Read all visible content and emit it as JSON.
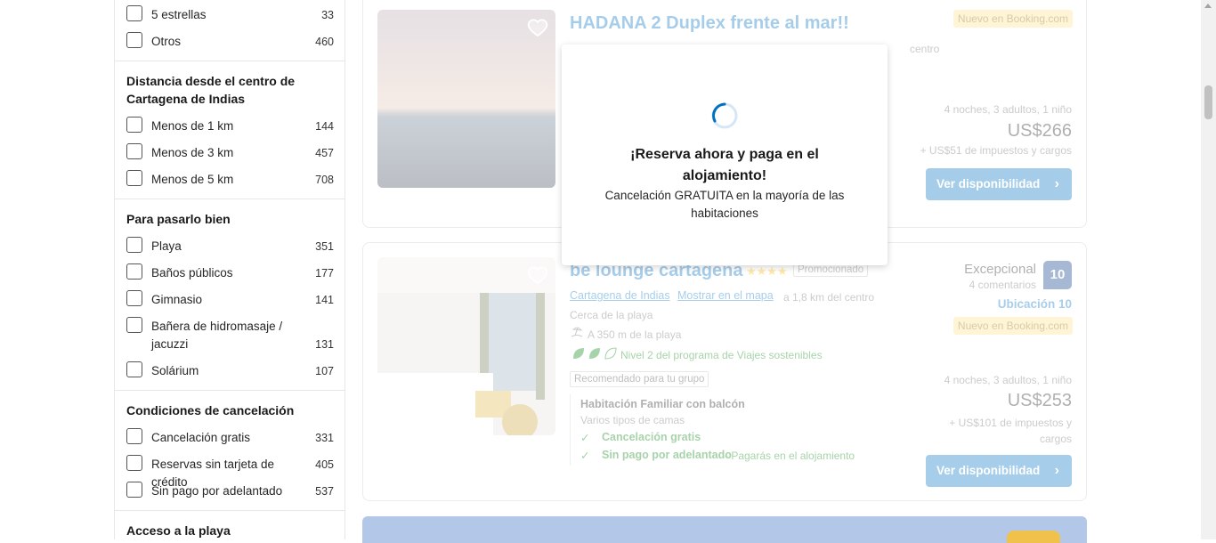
{
  "sidebar": {
    "stars": [
      {
        "label": "5 estrellas",
        "count": "33"
      },
      {
        "label": "Otros",
        "count": "460"
      }
    ],
    "distance": {
      "title": "Distancia desde el centro de Cartagena de Indias",
      "items": [
        {
          "label": "Menos de 1 km",
          "count": "144"
        },
        {
          "label": "Menos de 3 km",
          "count": "457"
        },
        {
          "label": "Menos de 5 km",
          "count": "708"
        }
      ]
    },
    "fun": {
      "title": "Para pasarlo bien",
      "items": [
        {
          "label": "Playa",
          "count": "351"
        },
        {
          "label": "Baños públicos",
          "count": "177"
        },
        {
          "label": "Gimnasio",
          "count": "141"
        },
        {
          "label": "Bañera de hidromasaje / jacuzzi",
          "count": "131"
        },
        {
          "label": "Solárium",
          "count": "107"
        }
      ]
    },
    "cancel": {
      "title": "Condiciones de cancelación",
      "items": [
        {
          "label": "Cancelación gratis",
          "count": "331"
        },
        {
          "label": "Reservas sin tarjeta de crédito",
          "count": "405"
        },
        {
          "label": "Sin pago por adelantado",
          "count": "537"
        }
      ]
    },
    "beach": {
      "title": "Acceso a la playa"
    }
  },
  "property1": {
    "title": "HADANA 2 Duplex frente al mar!!",
    "badge": "Nuevo en Booking.com",
    "subtitle_partial": "centro",
    "stay": "4 noches, 3 adultos, 1 niño",
    "price": "US$266",
    "taxes": "+ US$51 de impuestos y cargos",
    "button": "Ver disponibilidad"
  },
  "property2": {
    "title": "be lounge cartagena",
    "promoted": "Promocionado",
    "location_link": "Cartagena de Indias",
    "map_link": "Mostrar en el mapa",
    "distance": "a 1,8 km del centro",
    "near_beach": "Cerca de la playa",
    "beach_distance": "A 350 m de la playa",
    "sustainable": "Nivel 2 del programa de Viajes sostenibles",
    "group_tag": "Recomendado para tu grupo",
    "room": "Habitación Familiar con balcón",
    "beds": "Varios tipos de camas",
    "free_cancel": "Cancelación gratis",
    "no_prepay": "Sin pago por adelantado",
    "no_prepay_note": "- Pagarás en el alojamiento",
    "rating_word": "Excepcional",
    "reviews": "4 comentarios",
    "score": "10",
    "location_score": "Ubicación 10",
    "badge": "Nuevo en Booking.com",
    "stay": "4 noches, 3 adultos, 1 niño",
    "price": "US$253",
    "taxes": "+ US$101 de impuestos y cargos",
    "button": "Ver disponibilidad"
  },
  "modal": {
    "title": "¡Reserva ahora y paga en el alojamiento!",
    "text": "Cancelación GRATUITA en la mayoría de las habitaciones"
  },
  "colors": {
    "accent": "#0071c2",
    "badge": "#ffe08a",
    "green": "#008009"
  },
  "icons": {
    "favorite": "heart-icon",
    "chevron": "chevron-right-icon",
    "check": "check-icon",
    "beach": "beach-icon",
    "leaf": "leaf-icon",
    "spinner": "loading-spinner-icon"
  }
}
